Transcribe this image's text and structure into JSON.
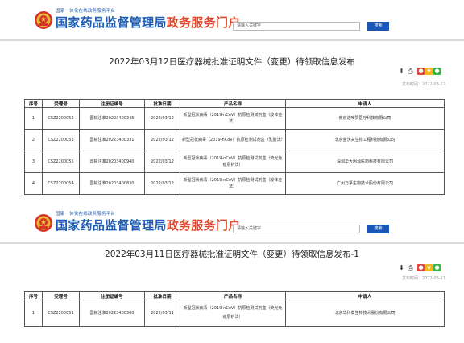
{
  "site": {
    "brand_small": "国家一体化在线政务服务平台",
    "brand_main": "国家药品监督管理局",
    "brand_accent": "政务服务门户",
    "search_placeholder": "请输入关键字",
    "search_button": "搜索"
  },
  "colors": {
    "brand_blue": "#1e5db3",
    "brand_red": "#e0472a",
    "search_button": "#1a56b5"
  },
  "icons": {
    "emblem": "national-emblem-icon",
    "download": "download-icon",
    "print": "print-icon",
    "weibo": "weibo-share-icon",
    "qzone": "qzone-share-icon",
    "wechat": "wechat-share-icon"
  },
  "notices": [
    {
      "title": "2022年03月12日医疗器械批准证明文件（变更）待领取信息发布",
      "pubdate": "发布时间：2022-03-12",
      "columns": [
        "序号",
        "受理号",
        "注册证编号",
        "批准日期",
        "产品名称",
        "申请人"
      ],
      "rows": [
        [
          "1",
          "CSZ2200052",
          "国械注准20223400346",
          "2022/03/12",
          "新型冠状病毒（2019-nCoV）抗原检测试剂盒（胶体金法）",
          "南京诺唯赞医疗科技有限公司"
        ],
        [
          "2",
          "CSZ2200053",
          "国械注准20223400331",
          "2022/03/12",
          "新型冠状病毒（2019-nCoV）抗原检测试剂盒（乳胶法）",
          "北京金沃夫生物工程科技有限公司"
        ],
        [
          "3",
          "CSZ2200055",
          "国械注准20203400940",
          "2022/03/12",
          "新型冠状病毒（2019-nCoV）抗原检测试剂盒（荧光免疫层析法）",
          "深圳华大因源医药科技有限公司"
        ],
        [
          "4",
          "CSZ2200054",
          "国械注准20203400830",
          "2022/03/12",
          "新型冠状病毒（2019-nCoV）抗原检测试剂盒（胶体金法）",
          "广州万孚生物技术股份有限公司"
        ]
      ]
    },
    {
      "title": "2022年03月11日医疗器械批准证明文件（变更）待领取信息发布-1",
      "pubdate": "发布时间：2022-03-11",
      "columns": [
        "序号",
        "受理号",
        "注册证编号",
        "批准日期",
        "产品名称",
        "申请人"
      ],
      "rows": [
        [
          "1",
          "CSZ2200051",
          "国械注准20223400300",
          "2022/03/11",
          "新型冠状病毒（2019-nCoV）抗原检测试剂盒（荧光免疫层析法）",
          "北京华科泰生物技术股份有限公司"
        ]
      ]
    }
  ]
}
